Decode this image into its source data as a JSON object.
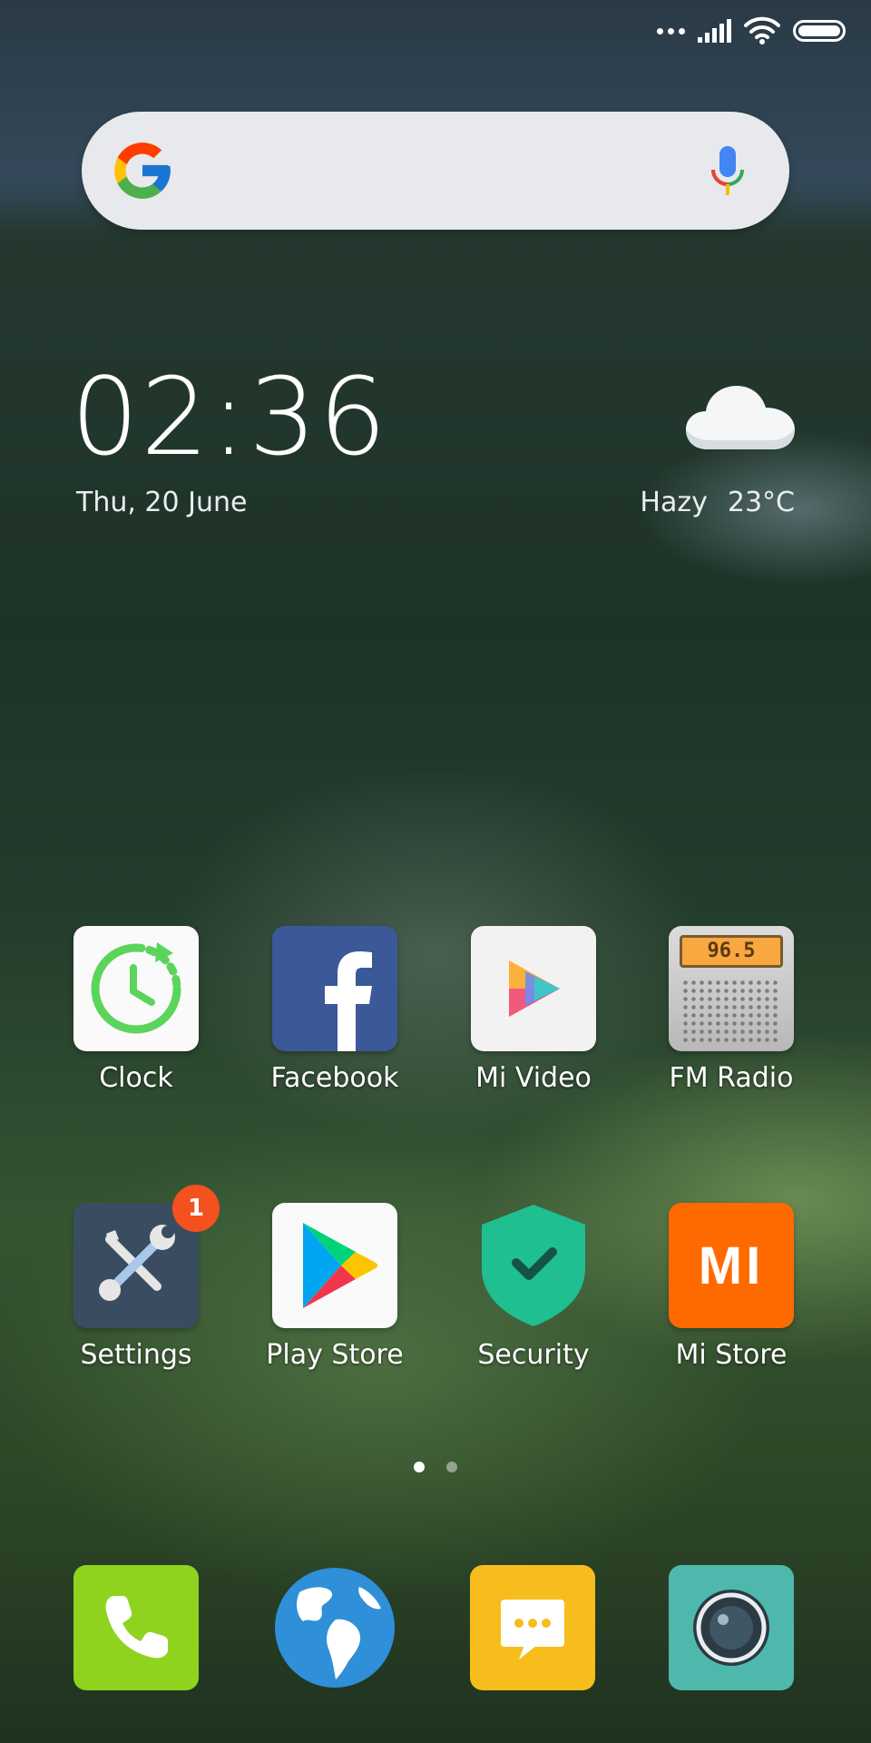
{
  "status_bar": {
    "icons": [
      "more-dots-icon",
      "signal-icon",
      "wifi-icon",
      "battery-icon"
    ]
  },
  "search_bar": {
    "logo": "google-g-icon",
    "mic": "mic-icon"
  },
  "clock_widget": {
    "time": "02:36",
    "date": "Thu, 20 June"
  },
  "weather_widget": {
    "condition": "Hazy",
    "temperature": "23°C",
    "icon": "cloud-icon"
  },
  "apps": [
    {
      "label": "Clock",
      "icon": "clock-icon"
    },
    {
      "label": "Facebook",
      "icon": "facebook-icon"
    },
    {
      "label": "Mi Video",
      "icon": "mi-video-icon"
    },
    {
      "label": "FM Radio",
      "icon": "fm-radio-icon",
      "display": "96.5"
    },
    {
      "label": "Settings",
      "icon": "settings-icon",
      "badge": "1"
    },
    {
      "label": "Play Store",
      "icon": "play-store-icon"
    },
    {
      "label": "Security",
      "icon": "security-shield-icon"
    },
    {
      "label": "Mi Store",
      "icon": "mi-store-icon",
      "logo_text": "MI"
    }
  ],
  "pager": {
    "pages": 2,
    "current": 1
  },
  "dock": [
    {
      "icon": "phone-icon"
    },
    {
      "icon": "browser-globe-icon"
    },
    {
      "icon": "messages-icon"
    },
    {
      "icon": "camera-icon"
    }
  ]
}
